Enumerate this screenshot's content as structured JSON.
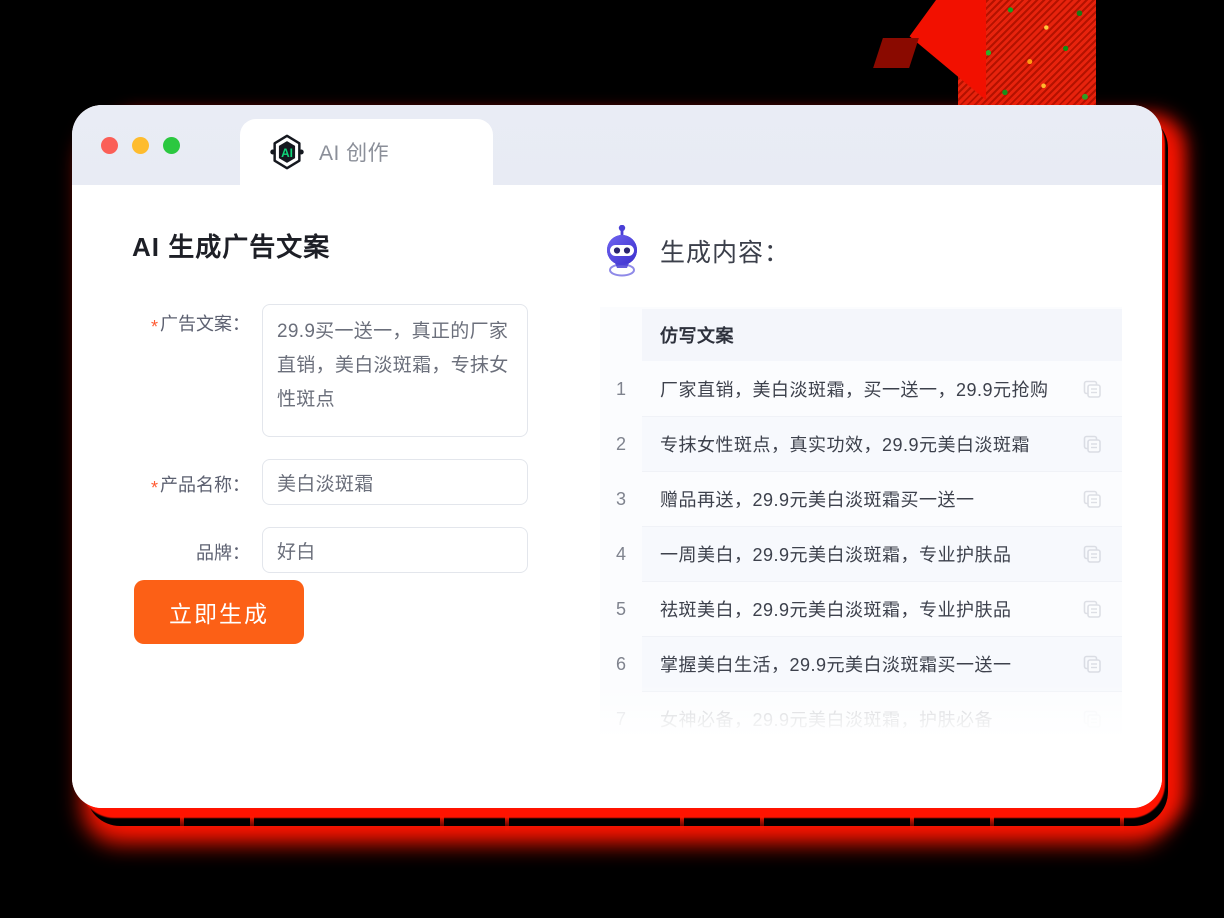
{
  "window": {
    "traffic_lights": [
      "close",
      "minimize",
      "maximize"
    ],
    "tab": {
      "label": "AI 创作",
      "logo_text": "AI"
    }
  },
  "left_panel": {
    "title": "AI 生成广告文案",
    "fields": [
      {
        "label": "广告文案：",
        "required": true,
        "value": "29.9买一送一，真正的厂家直销，美白淡斑霜，专抹女性斑点",
        "type": "textarea"
      },
      {
        "label": "产品名称：",
        "required": true,
        "value": "美白淡斑霜",
        "type": "input"
      },
      {
        "label": "品牌：",
        "required": false,
        "value": "好白",
        "type": "input"
      }
    ],
    "submit_label": "立即生成"
  },
  "right_panel": {
    "title": "生成内容：",
    "table": {
      "header": "仿写文案",
      "rows": [
        {
          "n": "1",
          "text": "厂家直销，美白淡斑霜，买一送一，29.9元抢购"
        },
        {
          "n": "2",
          "text": "专抹女性斑点，真实功效，29.9元美白淡斑霜"
        },
        {
          "n": "3",
          "text": "赠品再送，29.9元美白淡斑霜买一送一"
        },
        {
          "n": "4",
          "text": "一周美白，29.9元美白淡斑霜，专业护肤品"
        },
        {
          "n": "5",
          "text": "祛斑美白，29.9元美白淡斑霜，专业护肤品"
        },
        {
          "n": "6",
          "text": "掌握美白生活，29.9元美白淡斑霜买一送一"
        },
        {
          "n": "7",
          "text": "女神必备，29.9元美白淡斑霜，护肤必备"
        }
      ]
    }
  },
  "colors": {
    "accent": "#fc6016",
    "required_star": "#ff5b33",
    "logo_green": "#0fd77a",
    "robot_blue": "#4a3fd6",
    "titlebar": "#e9ecf5",
    "glow_red": "#ff1300"
  }
}
